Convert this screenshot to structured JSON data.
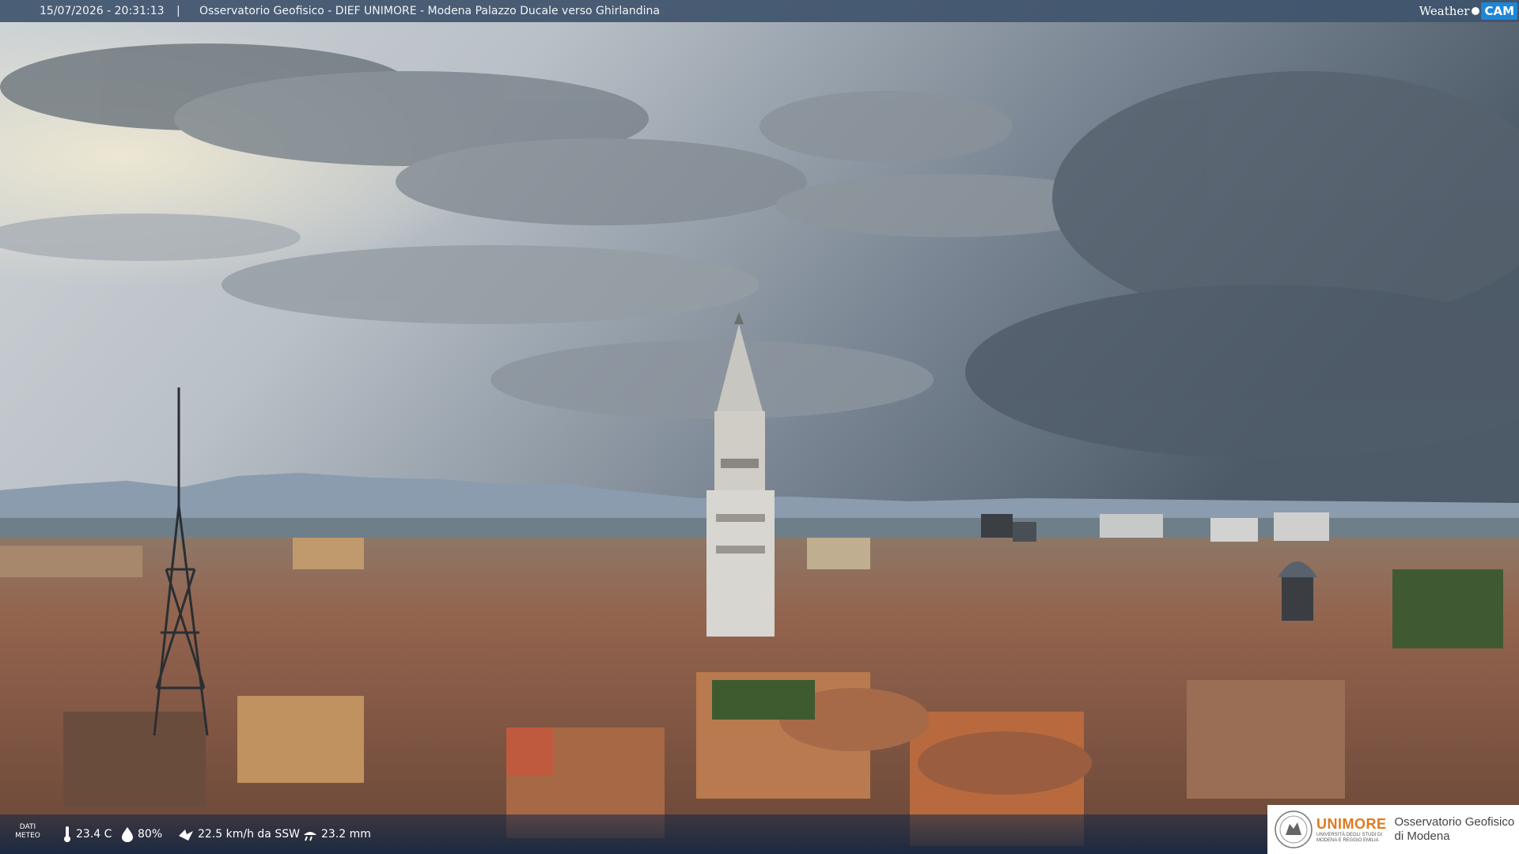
{
  "header": {
    "timestamp": "15/07/2026 - 20:31:13",
    "separator": "|",
    "camera_title": "Osservatorio Geofisico - DIEF UNIMORE - Modena Palazzo Ducale verso Ghirlandina",
    "logo_weather": "Weather",
    "logo_cam": "CAM"
  },
  "weather": {
    "dati_label_1": "DATI",
    "dati_label_2": "METEO",
    "temperature": "23.4 C",
    "humidity": "80%",
    "wind": "22.5 km/h da SSW",
    "rain": "23.2 mm",
    "icons": [
      "thermometer-icon",
      "humidity-drop-icon",
      "wind-icon",
      "rain-gauge-icon"
    ]
  },
  "institution": {
    "brand": "UNIMORE",
    "brand_sub": "UNIVERSITÀ DEGLI STUDI DI MODENA E REGGIO EMILIA",
    "name_line1": "Osservatorio Geofisico",
    "name_line2": "di Modena"
  },
  "colors": {
    "topbar": "#3f546c",
    "accent_orange": "#e07a1f",
    "cam_blue": "#1f86d6"
  }
}
